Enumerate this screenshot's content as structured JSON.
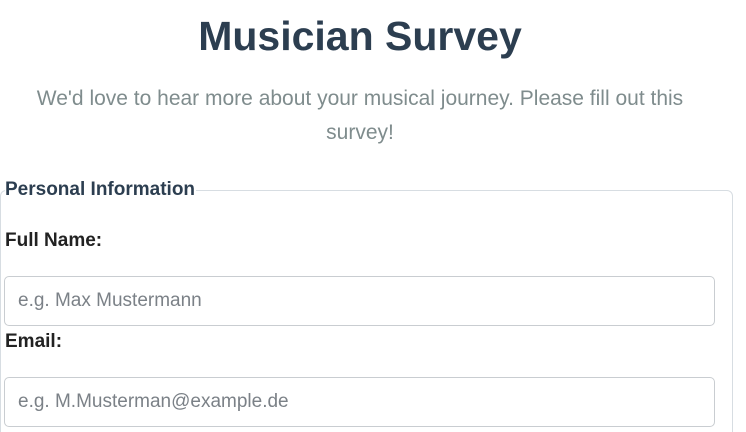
{
  "header": {
    "title": "Musician Survey",
    "subtitle": "We'd love to hear more about your musical journey. Please fill out this survey!"
  },
  "personal_information": {
    "legend": "Personal Information",
    "full_name": {
      "label": "Full Name:",
      "placeholder": "e.g. Max Mustermann",
      "value": ""
    },
    "email": {
      "label": "Email:",
      "placeholder": "e.g. M.Musterman@example.de",
      "value": ""
    }
  }
}
